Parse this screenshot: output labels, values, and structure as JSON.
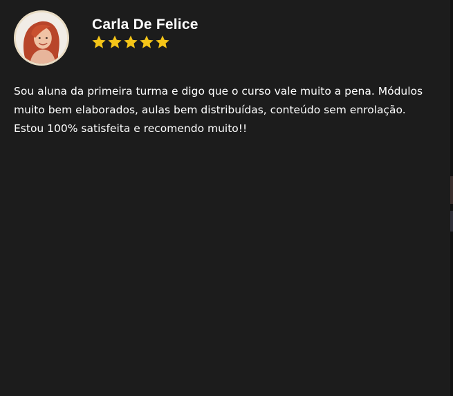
{
  "reviewer": {
    "name": "Carla De Felice",
    "avatar_icon": "avatar-photo"
  },
  "rating": {
    "value": 5,
    "max": 5,
    "star_color": "#f5c518"
  },
  "review": {
    "text": "Sou aluna da primeira turma e digo que o curso vale muito a pena. Módulos muito bem elaborados, aulas bem distribuídas, conteúdo sem enrolação. Estou 100% satisfeita e recomendo muito!!"
  },
  "colors": {
    "background": "#1c1c1c",
    "text": "#ffffff"
  }
}
